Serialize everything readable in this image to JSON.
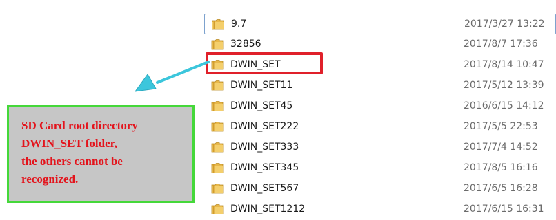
{
  "files": [
    {
      "name": "9.7",
      "date": "2017/3/27 13:22",
      "icon": "folder-icon"
    },
    {
      "name": "32856",
      "date": "2017/8/7 17:36",
      "icon": "folder-icon"
    },
    {
      "name": "DWIN_SET",
      "date": "2017/8/14 10:47",
      "icon": "folder-icon"
    },
    {
      "name": "DWIN_SET11",
      "date": "2017/5/12 13:39",
      "icon": "folder-icon"
    },
    {
      "name": "DWIN_SET45",
      "date": "2016/6/15 14:12",
      "icon": "folder-icon"
    },
    {
      "name": "DWIN_SET222",
      "date": "2017/5/5 22:53",
      "icon": "folder-icon"
    },
    {
      "name": "DWIN_SET333",
      "date": "2017/7/4 14:52",
      "icon": "folder-icon"
    },
    {
      "name": "DWIN_SET345",
      "date": "2017/8/5 16:16",
      "icon": "folder-icon"
    },
    {
      "name": "DWIN_SET567",
      "date": "2017/6/5 16:28",
      "icon": "folder-icon"
    },
    {
      "name": "DWIN_SET1212",
      "date": "2017/6/15 16:31",
      "icon": "folder-icon"
    }
  ],
  "annotation": {
    "lines": [
      "SD Card root directory",
      "DWIN_SET folder,",
      "the others cannot be",
      "recognized."
    ]
  },
  "colors": {
    "highlight": "#e0202a",
    "callout_border": "#45d83a",
    "callout_bg": "#c6c6c6",
    "callout_text": "#e3141c",
    "arrow": "#3cc6dc",
    "folder": "#e8b84a"
  }
}
